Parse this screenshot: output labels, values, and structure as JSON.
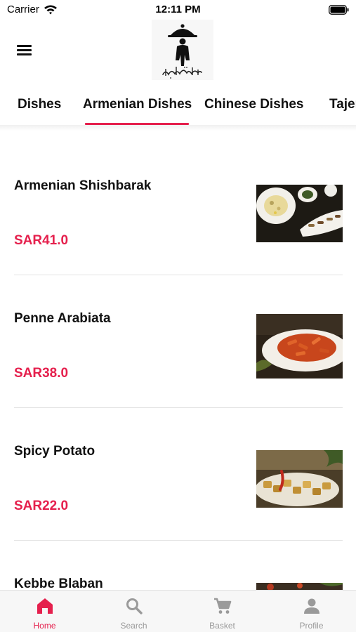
{
  "status_bar": {
    "carrier": "Carrier",
    "time": "12:11 PM"
  },
  "tabs": [
    {
      "label": "Dishes"
    },
    {
      "label": "Armenian Dishes",
      "active": true
    },
    {
      "label": "Chinese Dishes"
    },
    {
      "label": "Tajer"
    }
  ],
  "dishes": [
    {
      "name": "Armenian Shishbarak",
      "price": "SAR41.0"
    },
    {
      "name": "Penne Arabiata",
      "price": "SAR38.0"
    },
    {
      "name": "Spicy Potato",
      "price": "SAR22.0"
    },
    {
      "name": "Kebbe Blaban",
      "price": ""
    }
  ],
  "bottom_nav": [
    {
      "label": "Home",
      "icon": "home-icon",
      "active": true
    },
    {
      "label": "Search",
      "icon": "search-icon"
    },
    {
      "label": "Basket",
      "icon": "cart-icon"
    },
    {
      "label": "Profile",
      "icon": "person-icon"
    }
  ],
  "colors": {
    "accent": "#e5204d",
    "inactive": "#9a9a9a",
    "text": "#111111",
    "nav_bg": "#f7f7f7"
  }
}
